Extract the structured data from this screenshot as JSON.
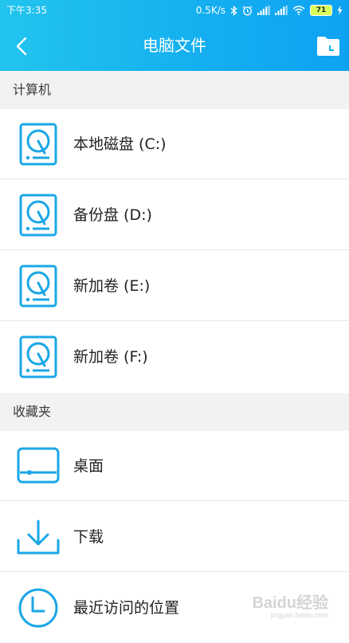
{
  "status": {
    "time": "下午3:35",
    "net_speed": "0.5K/s",
    "battery": "71"
  },
  "header": {
    "title": "电脑文件"
  },
  "sections": [
    {
      "title": "计算机",
      "items": [
        {
          "label": "本地磁盘 (C:)",
          "icon": "hard-drive-icon"
        },
        {
          "label": "备份盘 (D:)",
          "icon": "hard-drive-icon"
        },
        {
          "label": "新加卷 (E:)",
          "icon": "hard-drive-icon"
        },
        {
          "label": "新加卷 (F:)",
          "icon": "hard-drive-icon"
        }
      ]
    },
    {
      "title": "收藏夹",
      "items": [
        {
          "label": "桌面",
          "icon": "desktop-icon"
        },
        {
          "label": "下载",
          "icon": "download-icon"
        },
        {
          "label": "最近访问的位置",
          "icon": "clock-icon"
        }
      ]
    }
  ],
  "watermark": {
    "brand": "Baidu经验",
    "url": "jingyan.baidu.com"
  },
  "colors": {
    "accent": "#14aef0",
    "icon": "#1aa7e6"
  }
}
